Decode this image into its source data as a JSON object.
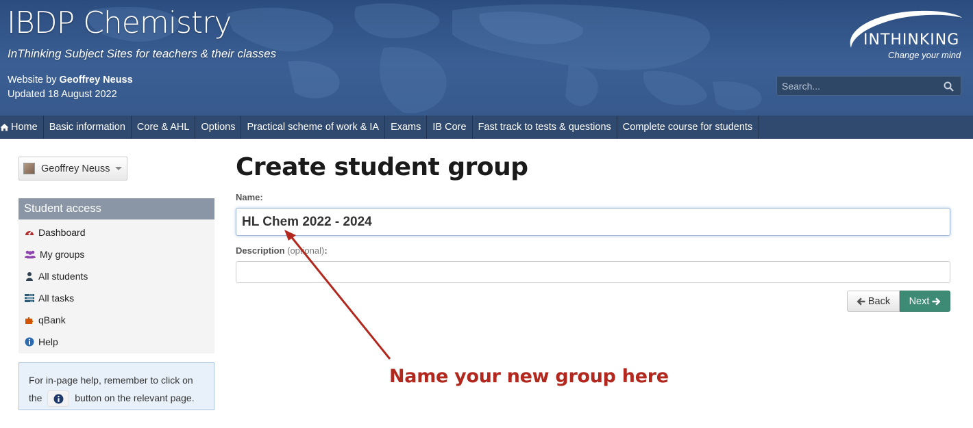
{
  "header": {
    "site_title": "IBDP Chemistry",
    "tagline": "InThinking Subject Sites for teachers & their classes",
    "credit_prefix": "Website by ",
    "credit_author": "Geoffrey Neuss",
    "updated": "Updated 18 August 2022",
    "logo_word": "INTHINKING",
    "logo_slogan": "Change your mind",
    "search_placeholder": "Search..."
  },
  "nav": {
    "items": [
      "Home",
      "Basic information",
      "Core & AHL",
      "Options",
      "Practical scheme of work & IA",
      "Exams",
      "IB Core",
      "Fast track to tests & questions",
      "Complete course for students"
    ]
  },
  "sidebar": {
    "user_name": "Geoffrey Neuss",
    "panel_title": "Student access",
    "menu": [
      {
        "label": "Dashboard",
        "icon": "dashboard-icon",
        "color": "#b22c2c"
      },
      {
        "label": "My groups",
        "icon": "groups-icon",
        "color": "#8e44ad"
      },
      {
        "label": "All students",
        "icon": "user-icon",
        "color": "#2f4050"
      },
      {
        "label": "All tasks",
        "icon": "tasks-icon",
        "color": "#2f5a73"
      },
      {
        "label": "qBank",
        "icon": "puzzle-icon",
        "color": "#d35400"
      },
      {
        "label": "Help",
        "icon": "info-icon",
        "color": "#2b6cb0"
      }
    ],
    "help_text_1": "For in-page help, remember to click on the",
    "help_text_2": "button on the relevant page."
  },
  "main": {
    "title": "Create student group",
    "name_label": "Name:",
    "name_value": "HL Chem 2022 - 2024",
    "description_label": "Description",
    "description_optional": " (optional)",
    "description_colon": ":",
    "description_value": "",
    "back_label": "Back",
    "next_label": "Next"
  },
  "annotation": {
    "text": "Name your new group here",
    "color": "#b2281e"
  },
  "colors": {
    "header_bg": "#2b4c7e",
    "nav_bg": "#30496e",
    "next_button": "#3d8b74",
    "panel_head": "#8a96a6"
  }
}
